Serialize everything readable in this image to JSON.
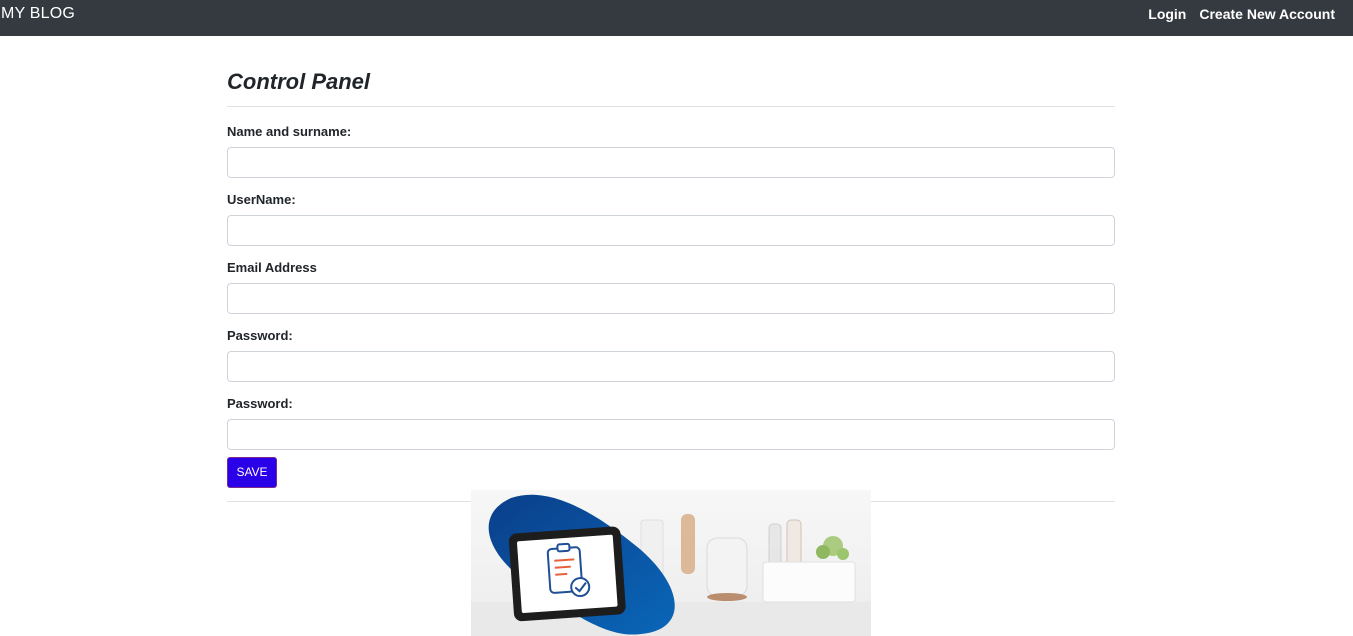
{
  "navbar": {
    "brand": "MY BLOG",
    "links": [
      {
        "label": "Login"
      },
      {
        "label": "Create New Account"
      }
    ]
  },
  "page": {
    "title": "Control Panel"
  },
  "form": {
    "fields": [
      {
        "label": "Name and surname:",
        "value": "",
        "placeholder": ""
      },
      {
        "label": "UserName:",
        "value": "",
        "placeholder": ""
      },
      {
        "label": "Email Address",
        "value": "",
        "placeholder": ""
      },
      {
        "label": "Password:",
        "value": "",
        "placeholder": ""
      },
      {
        "label": "Password:",
        "value": "",
        "placeholder": ""
      }
    ],
    "save_label": "SAVE"
  },
  "banner": {
    "icons": [
      "tablet-icon",
      "clipboard-icon",
      "checkmark-icon"
    ]
  },
  "colors": {
    "navbar_bg": "#343a40",
    "save_button_bg": "#2a00e8",
    "banner_blue": "#0b4f9c"
  }
}
